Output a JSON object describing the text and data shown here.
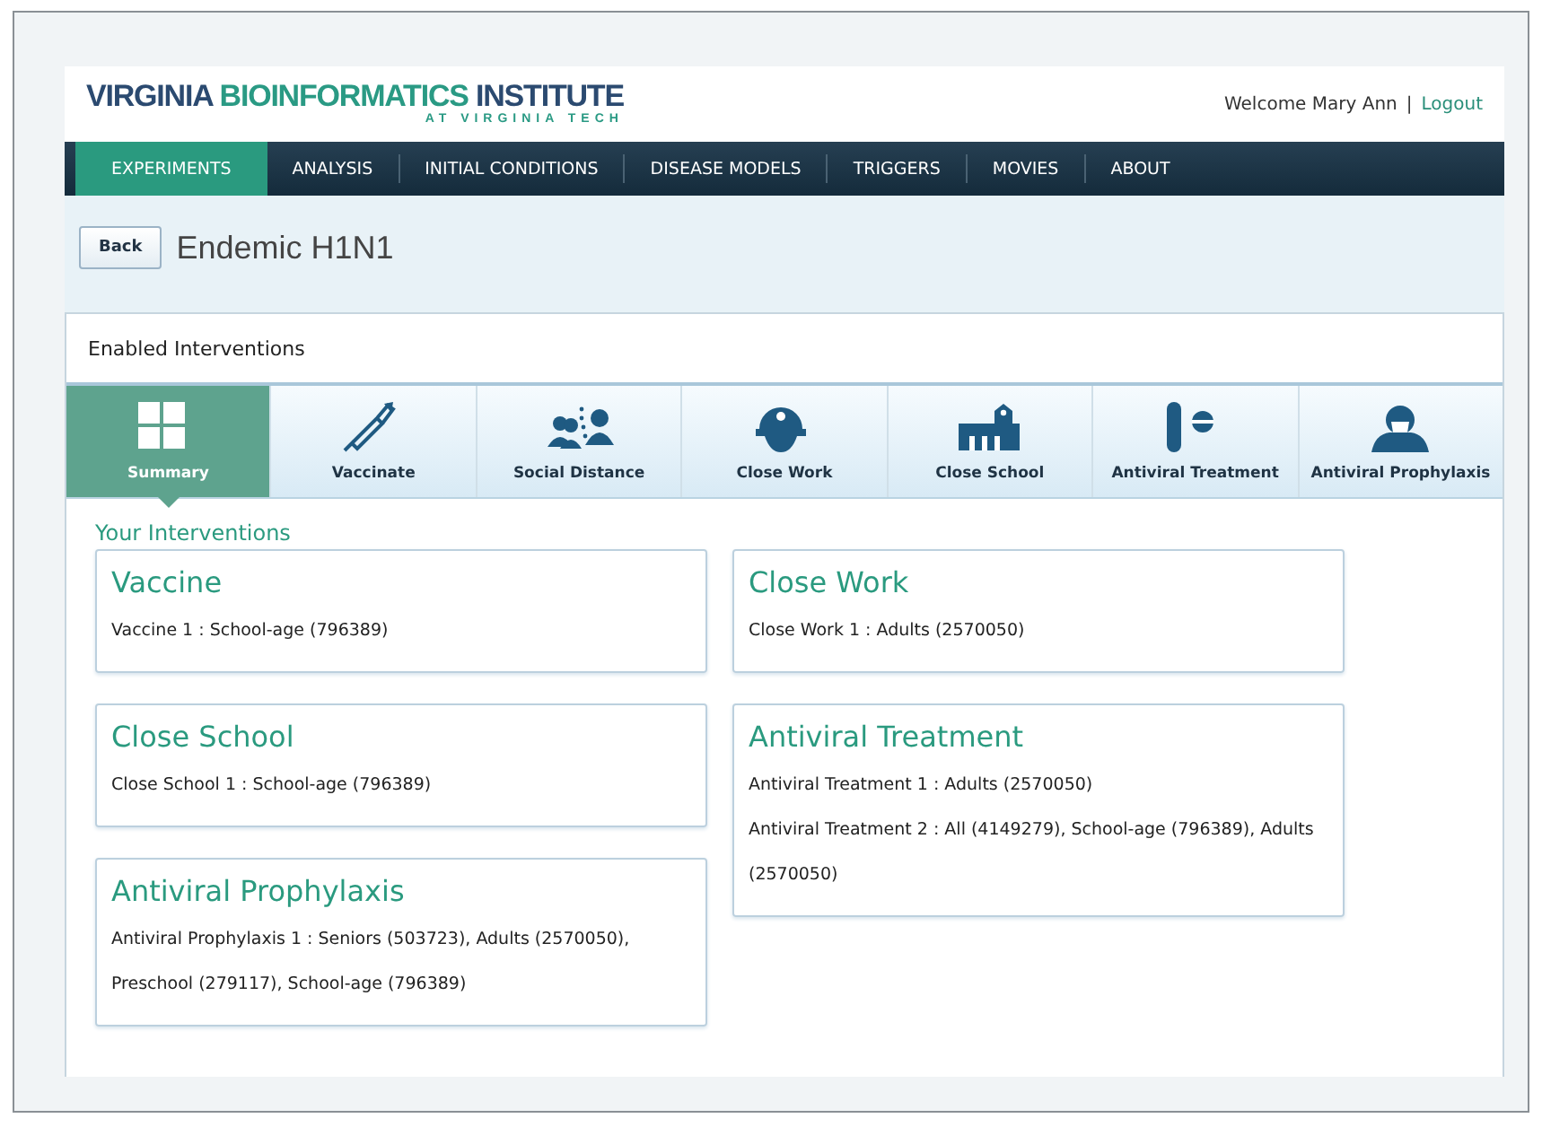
{
  "header": {
    "logo_parts": [
      {
        "text": "VIRGINIA ",
        "color": "#2b4a70"
      },
      {
        "text": "BIOINFORMATICS ",
        "color": "#2a9a84"
      },
      {
        "text": "INSTITUTE",
        "color": "#2b4a70"
      }
    ],
    "logo_subtitle": "AT VIRGINIA TECH",
    "welcome": "Welcome Mary Ann",
    "separator": "|",
    "logout": "Logout"
  },
  "nav": [
    {
      "label": "EXPERIMENTS",
      "selected": true
    },
    {
      "label": "ANALYSIS",
      "selected": false
    },
    {
      "label": "INITIAL CONDITIONS",
      "selected": false
    },
    {
      "label": "DISEASE MODELS",
      "selected": false
    },
    {
      "label": "TRIGGERS",
      "selected": false
    },
    {
      "label": "MOVIES",
      "selected": false
    },
    {
      "label": "ABOUT",
      "selected": false
    }
  ],
  "page": {
    "back": "Back",
    "title": "Endemic H1N1"
  },
  "panel": {
    "title": "Enabled Interventions",
    "tabs": [
      {
        "label": "Summary",
        "kind": "summary",
        "selected": true
      },
      {
        "label": "Vaccinate",
        "kind": "syringe",
        "selected": false
      },
      {
        "label": "Social Distance",
        "kind": "people",
        "selected": false
      },
      {
        "label": "Close Work",
        "kind": "helmet",
        "selected": false
      },
      {
        "label": "Close School",
        "kind": "school",
        "selected": false
      },
      {
        "label": "Antiviral Treatment",
        "kind": "pill",
        "selected": false
      },
      {
        "label": "Antiviral Prophylaxis",
        "kind": "mask",
        "selected": false
      }
    ],
    "section_title": "Your Interventions",
    "columns": [
      [
        {
          "title": "Vaccine",
          "lines": [
            "Vaccine 1 : School-age (796389)"
          ]
        },
        {
          "title": "Close School",
          "lines": [
            "Close School 1 : School-age (796389)"
          ]
        },
        {
          "title": "Antiviral Prophylaxis",
          "lines": [
            "Antiviral Prophylaxis 1 : Seniors (503723), Adults (2570050), Preschool (279117), School-age (796389)"
          ]
        }
      ],
      [
        {
          "title": "Close Work",
          "lines": [
            "Close Work 1 : Adults (2570050)"
          ]
        },
        {
          "title": "Antiviral Treatment",
          "lines": [
            "Antiviral Treatment 1 : Adults (2570050)",
            "Antiviral Treatment 2 : All (4149279), School-age (796389), Adults (2570050)"
          ]
        }
      ]
    ]
  }
}
